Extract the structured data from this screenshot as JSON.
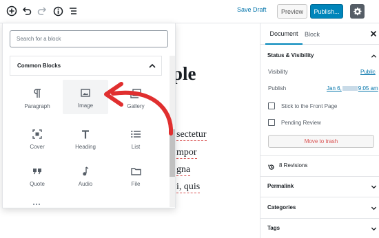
{
  "toolbar": {
    "icons": [
      "add-block-icon",
      "undo-icon",
      "redo-icon",
      "info-icon",
      "block-navigation-icon",
      "gear-icon"
    ],
    "save_draft": "Save Draft",
    "preview": "Preview",
    "publish": "Publish..."
  },
  "editor": {
    "title_partial": "ple",
    "lines": [
      "sectetur",
      "mpor",
      "gna",
      "i, quis"
    ]
  },
  "inserter": {
    "search_placeholder": "Search for a block",
    "category": "Common Blocks",
    "blocks": [
      {
        "label": "Paragraph",
        "icon": "paragraph-icon"
      },
      {
        "label": "Image",
        "icon": "image-icon",
        "highlighted": true
      },
      {
        "label": "Gallery",
        "icon": "gallery-icon"
      },
      {
        "label": "Cover",
        "icon": "cover-icon"
      },
      {
        "label": "Heading",
        "icon": "heading-icon"
      },
      {
        "label": "List",
        "icon": "list-icon"
      },
      {
        "label": "Quote",
        "icon": "quote-icon"
      },
      {
        "label": "Audio",
        "icon": "audio-icon"
      },
      {
        "label": "File",
        "icon": "file-icon"
      }
    ]
  },
  "annotation": {
    "color": "#e02f2f",
    "points_to": "Image"
  },
  "sidebar": {
    "tabs": [
      "Document",
      "Block"
    ],
    "status_section": {
      "title": "Status & Visibility",
      "visibility_label": "Visibility",
      "visibility_value": "Public",
      "publish_label": "Publish",
      "publish_value_start": "Jan 6,",
      "publish_value_end": "9:05 am",
      "stick_label": "Stick to the Front Page",
      "pending_label": "Pending Review",
      "trash_label": "Move to trash"
    },
    "revisions": "8 Revisions",
    "permalink": "Permalink",
    "categories": "Categories",
    "tags": "Tags"
  },
  "colors": {
    "accent": "#0085ba",
    "link": "#0073aa",
    "danger": "#d94f4f",
    "arrow": "#e02f2f"
  }
}
